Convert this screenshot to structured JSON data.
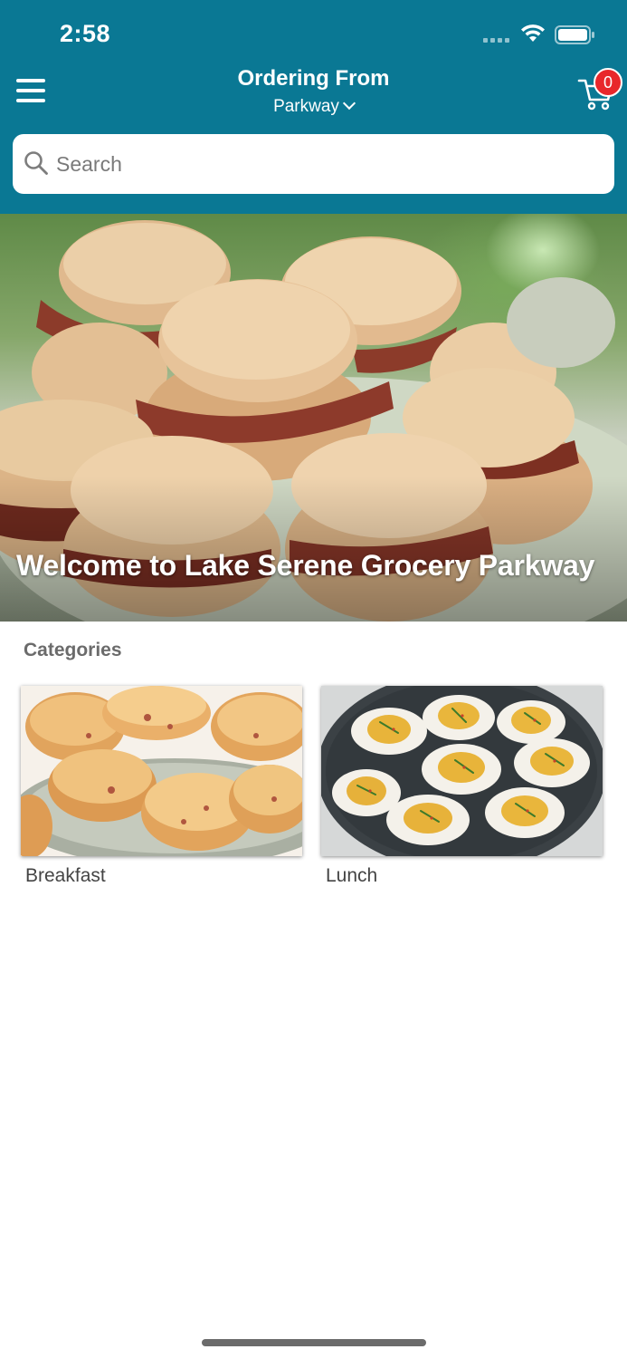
{
  "status_bar": {
    "time": "2:58"
  },
  "header": {
    "title": "Ordering From",
    "location": "Parkway",
    "cart_count": "0"
  },
  "search": {
    "placeholder": "Search"
  },
  "hero": {
    "title": "Welcome to Lake Serene Grocery Parkway"
  },
  "categories": {
    "heading": "Categories",
    "items": [
      {
        "label": "Breakfast"
      },
      {
        "label": "Lunch"
      }
    ]
  },
  "colors": {
    "brand": "#0a7894",
    "badge": "#e8272b",
    "background": "#ffffff"
  }
}
